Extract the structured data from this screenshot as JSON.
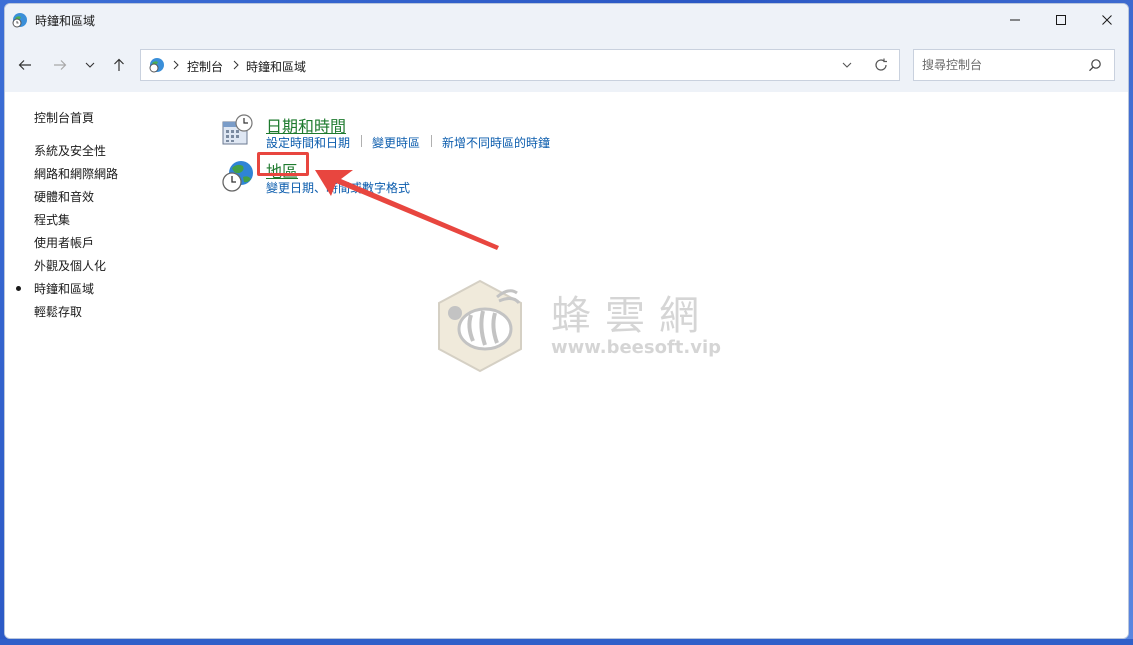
{
  "window": {
    "title": "時鐘和區域"
  },
  "navigation": {
    "breadcrumbs": [
      "控制台",
      "時鐘和區域"
    ],
    "search_placeholder": "搜尋控制台"
  },
  "sidebar": {
    "home": "控制台首頁",
    "items": [
      {
        "label": "系統及安全性"
      },
      {
        "label": "網路和網際網路"
      },
      {
        "label": "硬體和音效"
      },
      {
        "label": "程式集"
      },
      {
        "label": "使用者帳戶"
      },
      {
        "label": "外觀及個人化"
      },
      {
        "label": "時鐘和區域",
        "current": true
      },
      {
        "label": "輕鬆存取"
      }
    ]
  },
  "categories": [
    {
      "title": "日期和時間",
      "icon": "calendar-clock-icon",
      "links": [
        "設定時間和日期",
        "變更時區",
        "新增不同時區的時鐘"
      ]
    },
    {
      "title": "地區",
      "icon": "globe-clock-icon",
      "links": [
        "變更日期、時間或數字格式"
      ]
    }
  ],
  "annotation": {
    "color": "#e8463f"
  },
  "watermark": {
    "name": "蜂雲網",
    "url": "www.beesoft.vip"
  },
  "colors": {
    "link": "#0b5cad",
    "category_title": "#1e7a2e",
    "chrome": "#eef2f8"
  }
}
